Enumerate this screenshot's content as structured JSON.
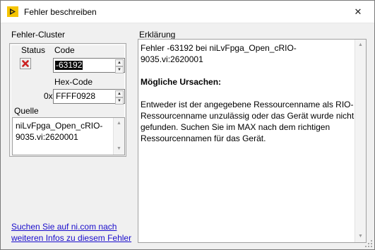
{
  "window": {
    "title": "Fehler beschreiben",
    "close_glyph": "✕"
  },
  "cluster": {
    "label": "Fehler-Cluster",
    "status_label": "Status",
    "status_value": "error",
    "code_label": "Code",
    "code_value": "-63192",
    "hex_label": "Hex-Code",
    "hex_prefix": "0x",
    "hex_value": "FFFF0928",
    "source_label": "Quelle",
    "source_value": "niLvFpga_Open_cRIO-9035.vi:2620001"
  },
  "explanation": {
    "label": "Erklärung",
    "line1": "Fehler -63192 bei niLvFpga_Open_cRIO-9035.vi:2620001",
    "heading": "Mögliche Ursachen:",
    "body": "Entweder ist der angegebene Ressourcenname als RIO-Ressourcenname unzulässig oder das Gerät wurde nicht gefunden. Suchen Sie im MAX nach dem richtigen Ressourcennamen für das Gerät."
  },
  "link": {
    "text": "Suchen Sie auf ni.com nach weiteren Infos zu diesem Fehler"
  },
  "colors": {
    "accent_link": "#1a0dcc",
    "status_error": "#cc2020",
    "app_icon": "#f5c400"
  }
}
